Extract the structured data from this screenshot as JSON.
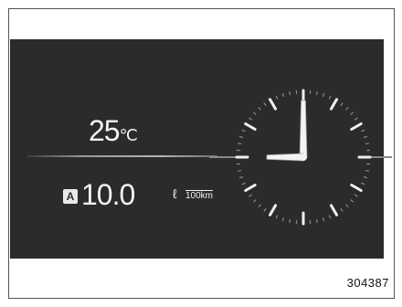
{
  "display": {
    "temperature": {
      "value": "25",
      "unit": "℃"
    },
    "fuel_economy": {
      "mode_badge": "A",
      "value": "10.0",
      "unit_prefix": "ℓ",
      "unit_numerator": "",
      "unit_denominator": "100km"
    },
    "clock": {
      "hour": 9,
      "minute": 0
    }
  },
  "figure_id": "304387"
}
